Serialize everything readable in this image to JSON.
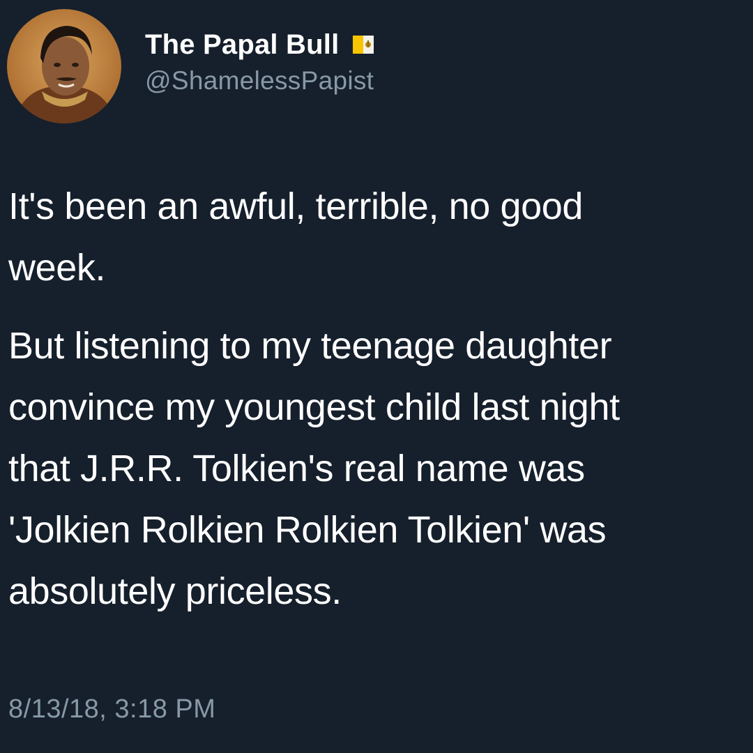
{
  "tweet": {
    "author": {
      "display_name": "The Papal Bull",
      "handle": "@ShamelessPapist",
      "badge_icon": "vatican-flag-icon",
      "avatar": "profile-avatar"
    },
    "paragraphs": [
      "It's been an awful, terrible, no good\nweek.",
      "But listening to my teenage daughter\nconvince my youngest child last night\nthat J.R.R. Tolkien's real name was\n'Jolkien Rolkien Rolkien Tolkien' was\nabsolutely priceless."
    ],
    "timestamp": "8/13/18, 3:18 PM"
  },
  "colors": {
    "background": "#16202c",
    "text": "#ffffff",
    "secondary_text": "#8899a6"
  }
}
